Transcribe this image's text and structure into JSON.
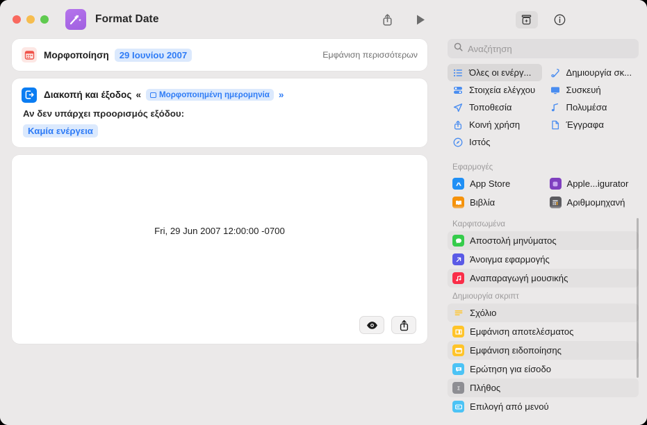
{
  "window": {
    "title": "Format Date",
    "app_icon": "shortcuts-icon",
    "traffic_lights": [
      "close",
      "minimize",
      "zoom"
    ],
    "accent_blue": "#2f7cf6",
    "toolbar": {
      "share_label": "share-icon",
      "play_label": "play-icon"
    }
  },
  "editor": {
    "card1": {
      "icon": "calendar-icon",
      "label": "Μορφοποίηση",
      "date_token": "29 Ιουνίου 2007",
      "show_more": "Εμφάνιση περισσότερων"
    },
    "card2": {
      "icon": "stop-and-output-icon",
      "label": "Διακοπή και έξοδος",
      "open_guillemet": "«",
      "close_guillemet": "»",
      "token": "Μορφοποιημένη ημερομηνία",
      "sub_label": "Αν δεν υπάρχει προορισμός εξόδου:",
      "sub_token": "Καμία ενέργεια"
    },
    "preview": {
      "output_text": "Fri, 29 Jun 2007 12:00:00 -0700",
      "buttons": [
        {
          "name": "quick-look-button",
          "icon": "eye-icon"
        },
        {
          "name": "share-output-button",
          "icon": "share-icon"
        }
      ]
    }
  },
  "sidebar": {
    "toolbar": [
      {
        "name": "action-library-button",
        "icon": "library-icon",
        "active": true
      },
      {
        "name": "info-button",
        "icon": "info-circle-icon",
        "active": false
      }
    ],
    "search": {
      "placeholder": "Αναζήτηση",
      "value": "",
      "icon": "search-icon"
    },
    "categories": [
      {
        "label": "Όλες οι ενέργ...",
        "icon": "list-bullet-icon",
        "selected": true
      },
      {
        "label": "Δημιουργία σκ...",
        "icon": "scripting-icon",
        "selected": false
      },
      {
        "label": "Στοιχεία ελέγχου",
        "icon": "controls-icon",
        "selected": false
      },
      {
        "label": "Συσκευή",
        "icon": "display-icon",
        "selected": false
      },
      {
        "label": "Τοποθεσία",
        "icon": "location-arrow-icon",
        "selected": false
      },
      {
        "label": "Πολυμέσα",
        "icon": "music-note-icon",
        "selected": false
      },
      {
        "label": "Κοινή χρήση",
        "icon": "share-icon",
        "selected": false
      },
      {
        "label": "Έγγραφα",
        "icon": "document-icon",
        "selected": false
      },
      {
        "label": "Ιστός",
        "icon": "safari-compass-icon",
        "selected": false
      }
    ],
    "apps_section": {
      "title": "Εφαρμογές",
      "items": [
        {
          "label": "App Store",
          "icon": "app-store-icon",
          "color": "#1f8ff5"
        },
        {
          "label": "Apple...igurator",
          "icon": "apple-configurator-icon",
          "color": "#7f3fbf"
        },
        {
          "label": "Βιβλία",
          "icon": "books-icon",
          "color": "#f5920b"
        },
        {
          "label": "Αριθμομηχανή",
          "icon": "calculator-icon",
          "color": "#5c5c60"
        }
      ]
    },
    "pinned_section": {
      "title": "Καρφιτσωμένα",
      "items": [
        {
          "label": "Αποστολή μηνύματος",
          "icon": "messages-icon",
          "color": "#35cc4b",
          "alt": true
        },
        {
          "label": "Άνοιγμα εφαρμογής",
          "icon": "open-app-icon",
          "color": "#5a5ae6",
          "alt": false
        },
        {
          "label": "Αναπαραγωγή μουσικής",
          "icon": "music-icon",
          "color": "#fa2d48",
          "alt": true
        }
      ]
    },
    "scripting_section": {
      "title": "Δημιουργία σκριπτ",
      "items": [
        {
          "label": "Σχόλιο",
          "icon": "comment-icon",
          "color": "#ffc429",
          "alt": true
        },
        {
          "label": "Εμφάνιση αποτελέσματος",
          "icon": "show-result-icon",
          "color": "#ffc429",
          "alt": false
        },
        {
          "label": "Εμφάνιση ειδοποίησης",
          "icon": "show-alert-icon",
          "color": "#ffc429",
          "alt": true
        },
        {
          "label": "Ερώτηση για είσοδο",
          "icon": "ask-for-input-icon",
          "color": "#4cc3f5",
          "alt": false
        },
        {
          "label": "Πλήθος",
          "icon": "count-icon",
          "color": "#8e8e93",
          "alt": true
        },
        {
          "label": "Επιλογή από μενού",
          "icon": "choose-from-menu-icon",
          "color": "#4cc3f5",
          "alt": false
        }
      ]
    }
  }
}
